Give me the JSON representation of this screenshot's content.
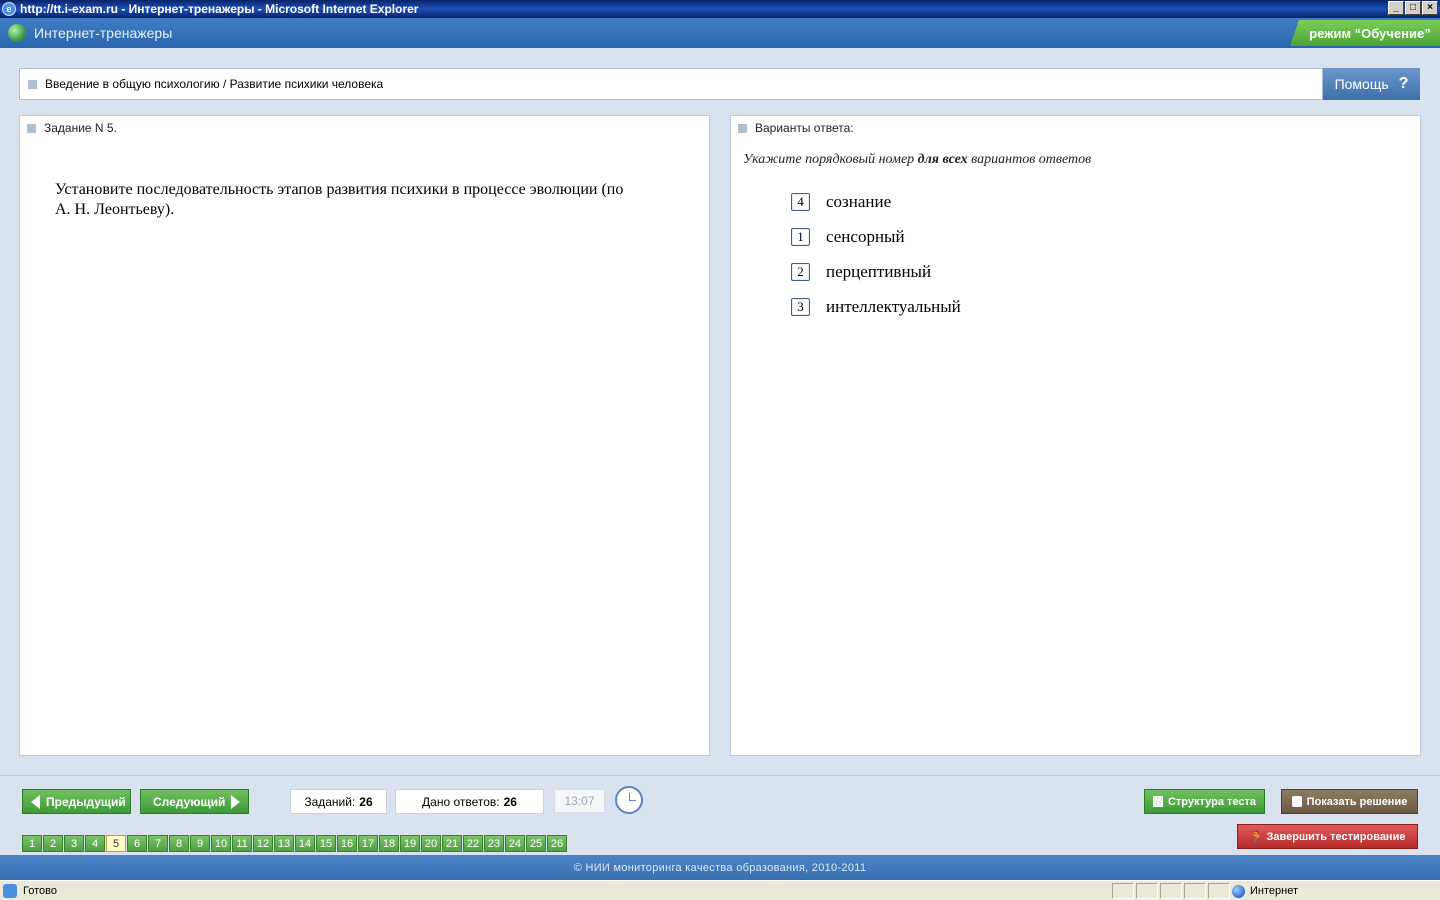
{
  "window": {
    "title": "http://tt.i-exam.ru - Интернет-тренажеры - Microsoft Internet Explorer"
  },
  "header": {
    "app_title": "Интернет-тренажеры",
    "mode": "режим “Обучение”"
  },
  "breadcrumb": {
    "text": "Введение в общую психологию / Развитие психики человека",
    "help_label": "Помощь"
  },
  "task": {
    "label": "Задание N 5.",
    "question": "Установите последовательность этапов развития психики в процессе эволюции (по А. Н. Леонтьеву)."
  },
  "answers": {
    "label": "Варианты ответа:",
    "instruction_pre": "Укажите порядковый номер ",
    "instruction_bold": "для всех",
    "instruction_post": " вариантов ответов",
    "items": [
      {
        "number": "4",
        "text": "сознание"
      },
      {
        "number": "1",
        "text": "сенсорный"
      },
      {
        "number": "2",
        "text": "перцептивный"
      },
      {
        "number": "3",
        "text": "интеллектуальный"
      }
    ]
  },
  "navigation": {
    "prev_label": "Предыдущий",
    "next_label": "Следующий",
    "tasks_label": "Заданий:",
    "tasks_count": "26",
    "answered_label": "Дано ответов:",
    "answered_count": "26",
    "timer": "13:07",
    "structure_label": "Структура теста",
    "solution_label": "Показать решение",
    "finish_label": "Завершить тестирование",
    "pages": [
      "1",
      "2",
      "3",
      "4",
      "5",
      "6",
      "7",
      "8",
      "9",
      "10",
      "11",
      "12",
      "13",
      "14",
      "15",
      "16",
      "17",
      "18",
      "19",
      "20",
      "21",
      "22",
      "23",
      "24",
      "25",
      "26"
    ],
    "active_page": "5"
  },
  "footer": {
    "copyright": "© НИИ мониторинга качества образования, 2010-2011"
  },
  "status": {
    "left": "Готово",
    "zone": "Интернет"
  }
}
